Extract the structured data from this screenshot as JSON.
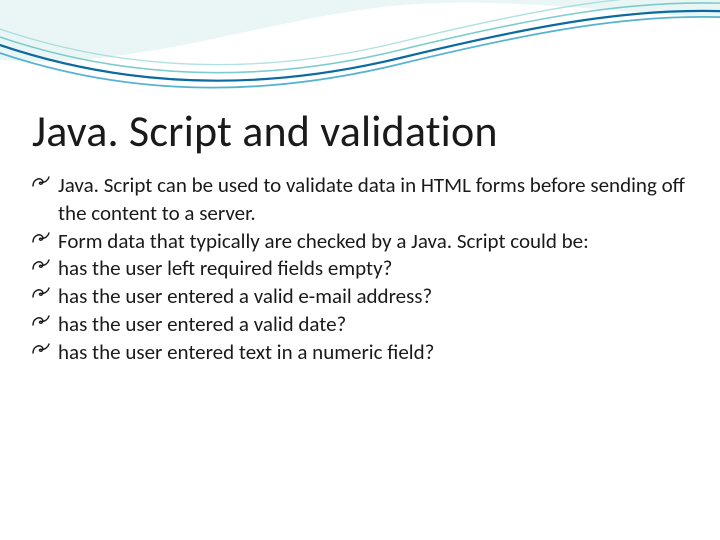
{
  "title": "Java. Script and validation",
  "bullets": [
    "Java. Script can be used to validate data in HTML forms before sending off the content to a server.",
    "Form data that typically are checked by a Java. Script could be:",
    "has the user left required fields empty?",
    "has the user entered a valid e-mail address?",
    "has the user entered a valid date?",
    "has the user entered text in a numeric field?"
  ],
  "theme": {
    "swirl_dark": "#0b6aa0",
    "swirl_light": "#6fc7c7",
    "text": "#1a1a1a"
  }
}
